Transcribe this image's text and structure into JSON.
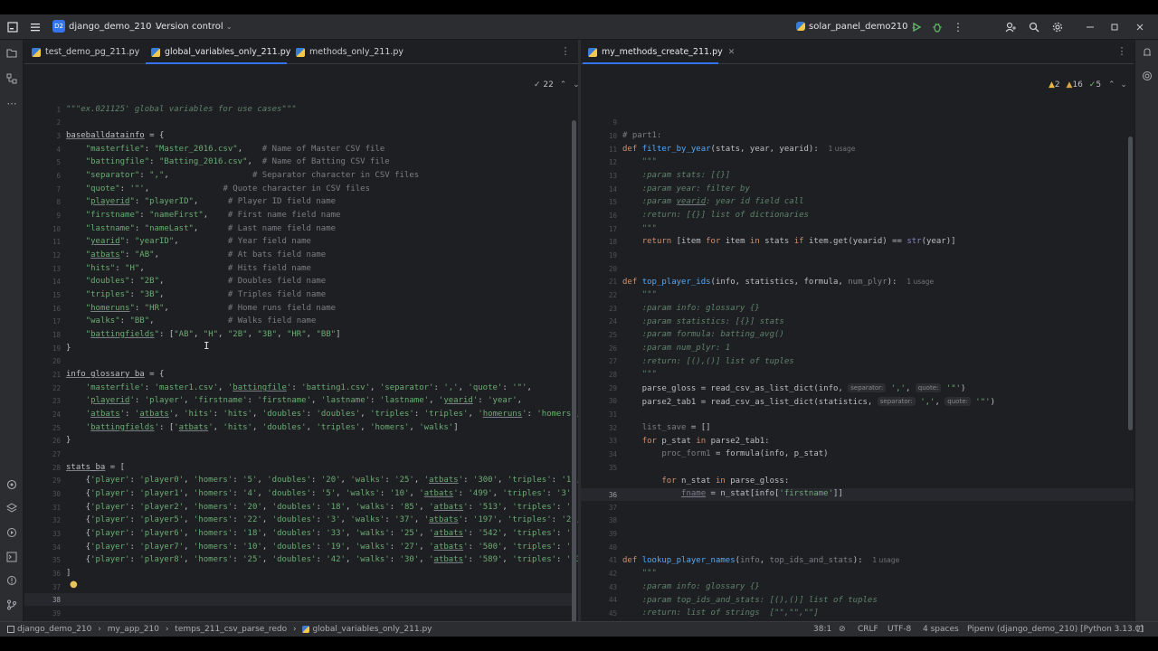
{
  "window": {
    "project_badge": "D2",
    "project_name": "django_demo_210",
    "vcs_menu": "Version control",
    "run_config": "solar_panel_demo210"
  },
  "left_editor": {
    "tabs": [
      {
        "label": "test_demo_pg_211.py"
      },
      {
        "label": "global_variables_only_211.py"
      },
      {
        "label": "methods_only_211.py"
      }
    ],
    "inspection_count": "22",
    "current_line": "38"
  },
  "right_editor": {
    "tabs": [
      {
        "label": "my_methods_create_211.py"
      }
    ],
    "warnings": "2",
    "weak_warnings": "16",
    "typos": "5",
    "current_line": "36"
  },
  "status_bar": {
    "breadcrumb": [
      "django_demo_210",
      "my_app_210",
      "temps_211_csv_parse_redo",
      "global_variables_only_211.py"
    ],
    "caret": "38:1",
    "line_sep": "CRLF",
    "encoding": "UTF-8",
    "indent": "4 spaces",
    "interpreter": "Pipenv (django_demo_210) [Python 3.13.0]"
  },
  "colors": {
    "accent": "#3574f0",
    "background": "#1e1f22",
    "chrome": "#2b2d30",
    "run_green": "#5fb865"
  }
}
